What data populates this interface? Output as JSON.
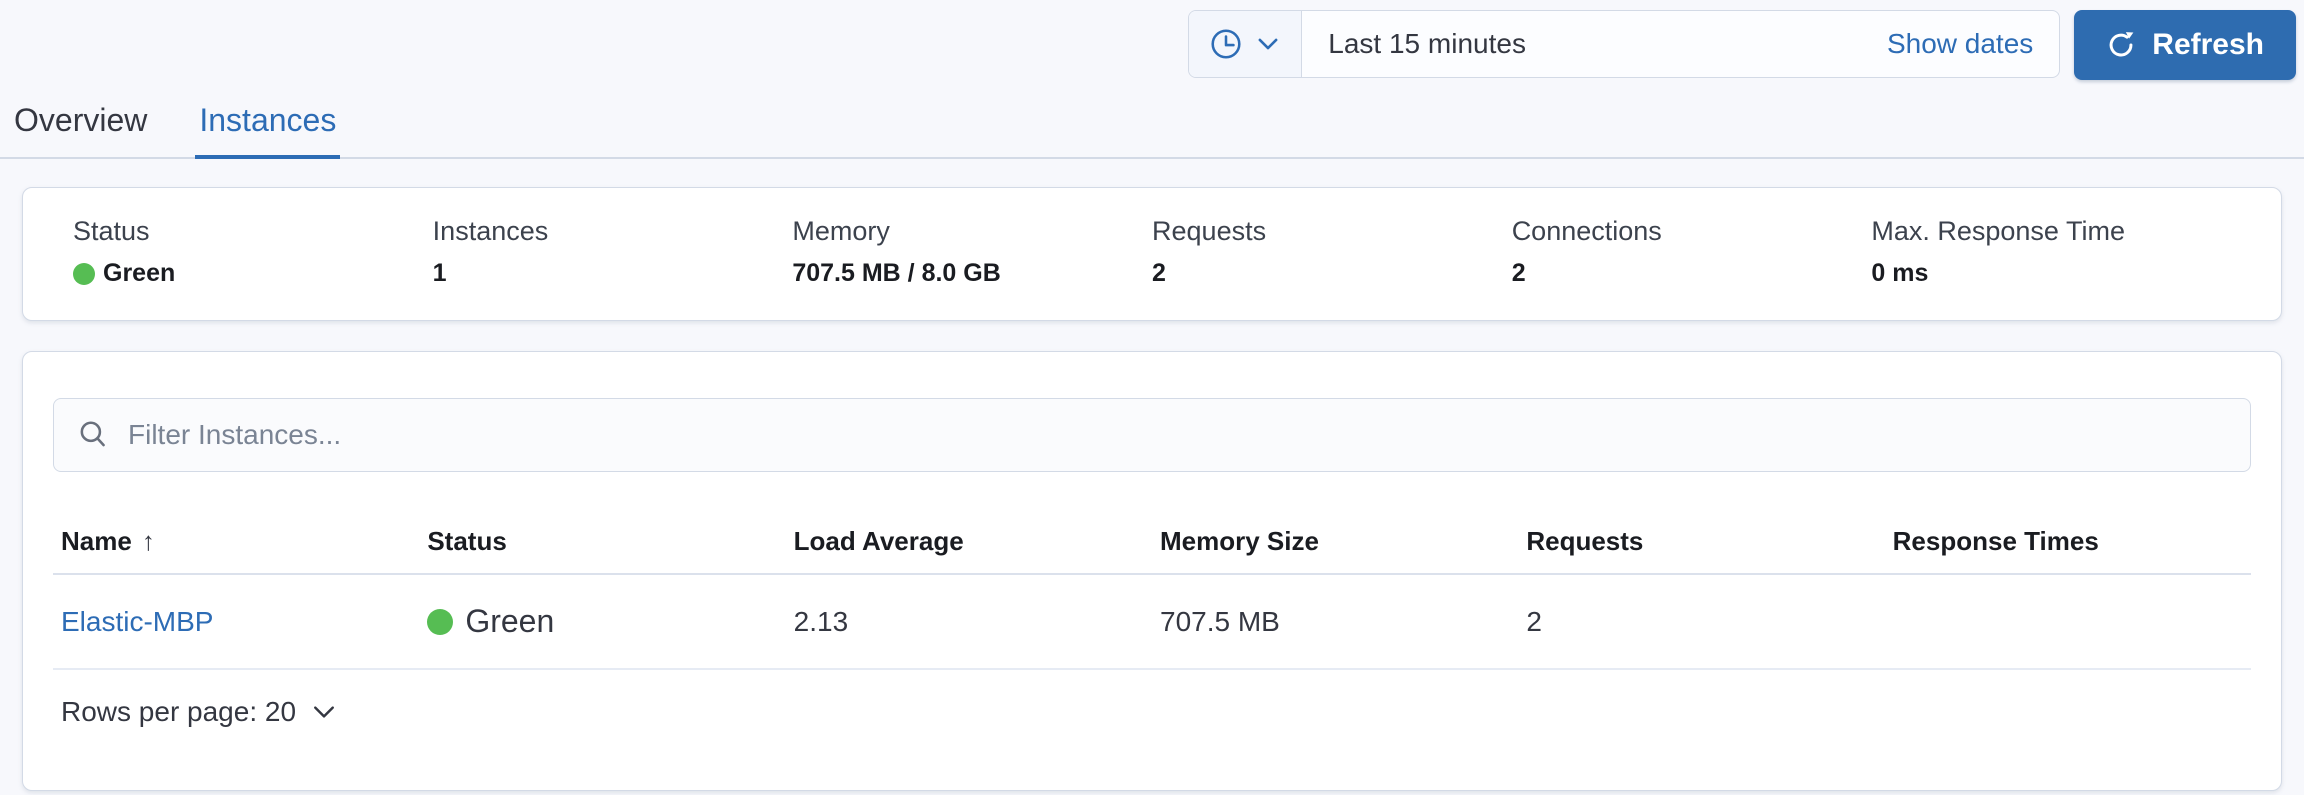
{
  "colors": {
    "accent_blue": "#2d6cb5",
    "button_blue": "#2e6cb0",
    "health_green": "#56bd53",
    "panel_border": "#d3dae6",
    "page_background": "#f7f8fc",
    "text": "#343741",
    "health_dot_style": "background:#56bd53"
  },
  "icons": {
    "clock": "clock-icon",
    "chevron_down": "chevron-down-icon",
    "refresh": "refresh-icon",
    "search": "search-icon",
    "sort_ascending": "↑"
  },
  "time_filter": {
    "value": "Last 15 minutes",
    "show_dates_label": "Show dates",
    "refresh_label": "Refresh"
  },
  "tabs": {
    "overview": "Overview",
    "instances": "Instances",
    "active_tab": "Instances"
  },
  "summary": {
    "stats": [
      {
        "label": "Status",
        "value": "Green",
        "health": true
      },
      {
        "label": "Instances",
        "value": "1"
      },
      {
        "label": "Memory",
        "value": "707.5 MB / 8.0 GB"
      },
      {
        "label": "Requests",
        "value": "2"
      },
      {
        "label": "Connections",
        "value": "2"
      },
      {
        "label": "Max. Response Time",
        "value": "0 ms"
      }
    ]
  },
  "instances": {
    "filter_placeholder": "Filter Instances...",
    "table": {
      "columns": [
        "Name",
        "Status",
        "Load Average",
        "Memory Size",
        "Requests",
        "Response Times"
      ],
      "sort_column": "Name",
      "sort_direction": "ascending",
      "sort_icon": "↑",
      "rows": [
        {
          "name": "Elastic-MBP",
          "status": "Green",
          "load_average": "2.13",
          "memory_size": "707.5 MB",
          "requests": "2",
          "response_times": ""
        }
      ]
    },
    "pagination": {
      "rows_per_page_label": "Rows per page: 20"
    }
  }
}
